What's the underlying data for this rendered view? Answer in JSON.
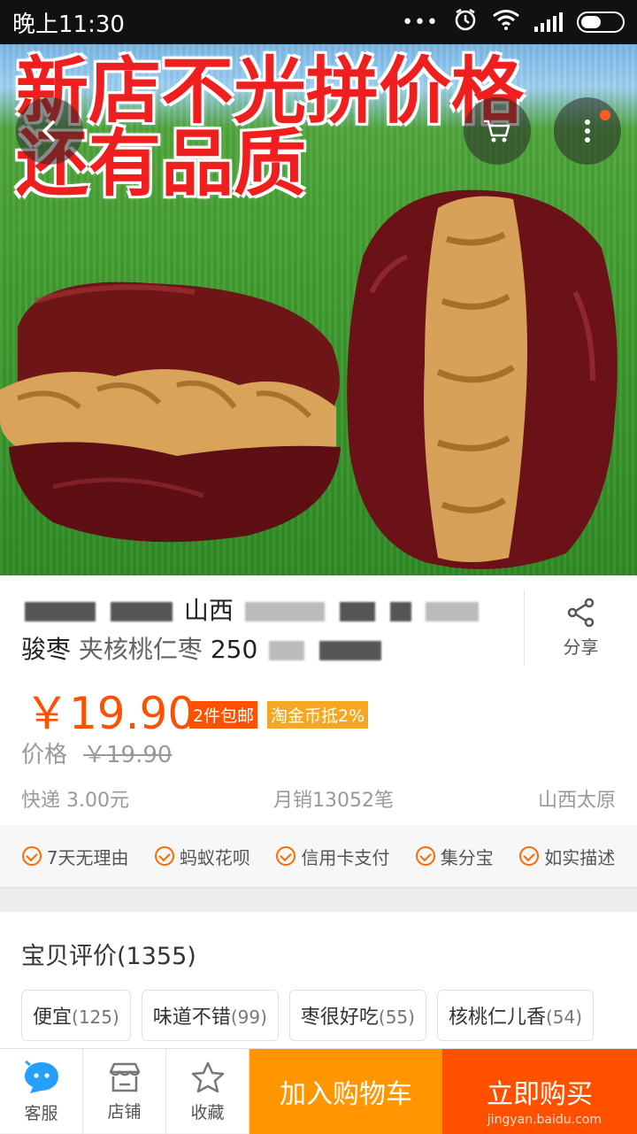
{
  "status_bar": {
    "time": "晚上11:30",
    "dots": "•••"
  },
  "hero": {
    "line1": "新店不光拼价格",
    "line2": "还有品质"
  },
  "product": {
    "title_line1": "山西",
    "title_line2_start": "骏枣",
    "title_line2_mid": "夹核桃仁枣",
    "title_line2_end": "250"
  },
  "share": {
    "label": "分享"
  },
  "price": {
    "current": "￥19.90",
    "badge_shipping": "2件包邮",
    "badge_coin": "淘金币抵2%",
    "orig_label": "价格",
    "orig_value": "￥19.90",
    "express": "快递 3.00元",
    "monthly_sales": "月销13052笔",
    "location": "山西太原"
  },
  "services": [
    {
      "label": "7天无理由"
    },
    {
      "label": "蚂蚁花呗"
    },
    {
      "label": "信用卡支付"
    },
    {
      "label": "集分宝"
    },
    {
      "label": "如实描述"
    }
  ],
  "reviews": {
    "title": "宝贝评价(1355)",
    "tags": [
      {
        "text": "便宜",
        "count": "(125)"
      },
      {
        "text": "味道不错",
        "count": "(99)"
      },
      {
        "text": "枣很好吃",
        "count": "(55)"
      },
      {
        "text": "核桃仁儿香",
        "count": "(54)"
      }
    ]
  },
  "bottom_bar": {
    "service_label": "客服",
    "shop_label": "店铺",
    "fav_label": "收藏",
    "add_cart_label": "加入购物车",
    "buy_now_label": "立即购买",
    "watermark": "jingyan.baidu.com"
  },
  "colors": {
    "accent": "#ff5000",
    "cart": "#ff9500"
  }
}
